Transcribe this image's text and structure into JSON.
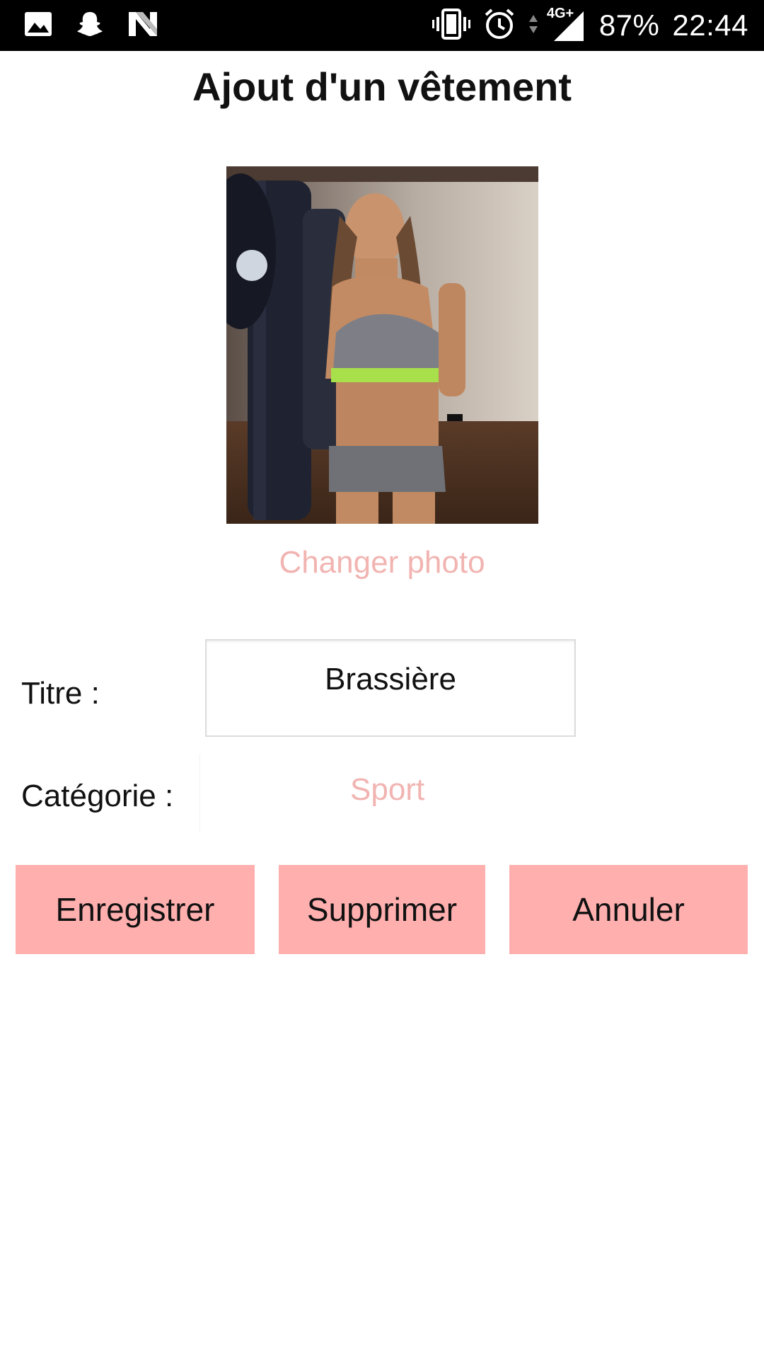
{
  "status_bar": {
    "battery": "87%",
    "time": "22:44",
    "network": "4G+",
    "left_icons": [
      "gallery-icon",
      "snapchat-icon",
      "n-app-icon"
    ],
    "right_icons": [
      "vibrate-icon",
      "alarm-icon",
      "data-arrows-icon",
      "signal-icon"
    ]
  },
  "header": {
    "title": "Ajout d'un vêtement"
  },
  "photo": {
    "change_label": "Changer photo"
  },
  "form": {
    "title_label": "Titre :",
    "title_value": "Brassière",
    "category_label": "Catégorie :",
    "category_value": "Sport"
  },
  "actions": {
    "save": "Enregistrer",
    "delete": "Supprimer",
    "cancel": "Annuler"
  },
  "colors": {
    "accent_pink": "#feafae",
    "link_pink": "#f1b4b1",
    "status_bar": "#000000"
  }
}
